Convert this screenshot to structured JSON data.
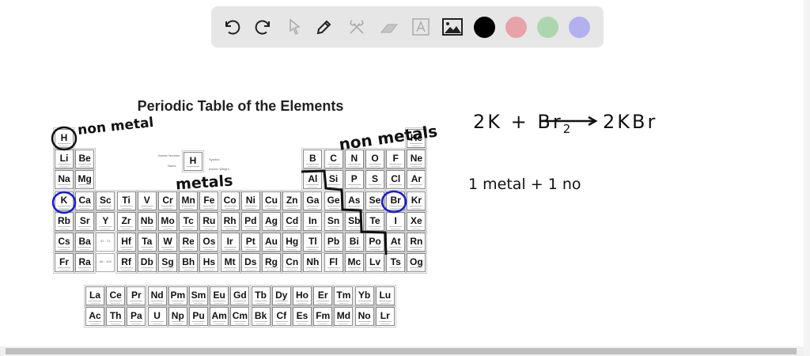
{
  "toolbar": {
    "tools": [
      "undo-icon",
      "redo-icon",
      "select-icon",
      "pen-icon",
      "tools-icon",
      "eraser-icon",
      "text-icon",
      "image-icon"
    ],
    "colors": [
      "#000000",
      "#e8a2aa",
      "#aed6ae",
      "#b2b0ee"
    ]
  },
  "periodic_table": {
    "title": "Periodic Table of the Elements",
    "rows": [
      [
        "H",
        "",
        "",
        "",
        "",
        "",
        "",
        "",
        "",
        "",
        "",
        "",
        "",
        "",
        "",
        "",
        "",
        "He"
      ],
      [
        "Li",
        "Be",
        "",
        "",
        "",
        "",
        "",
        "",
        "",
        "",
        "",
        "",
        "B",
        "C",
        "N",
        "O",
        "F",
        "Ne"
      ],
      [
        "Na",
        "Mg",
        "",
        "",
        "",
        "",
        "",
        "",
        "",
        "",
        "",
        "",
        "Al",
        "Si",
        "P",
        "S",
        "Cl",
        "Ar"
      ],
      [
        "K",
        "Ca",
        "Sc",
        "Ti",
        "V",
        "Cr",
        "Mn",
        "Fe",
        "Co",
        "Ni",
        "Cu",
        "Zn",
        "Ga",
        "Ge",
        "As",
        "Se",
        "Br",
        "Kr"
      ],
      [
        "Rb",
        "Sr",
        "Y",
        "Zr",
        "Nb",
        "Mo",
        "Tc",
        "Ru",
        "Rh",
        "Pd",
        "Ag",
        "Cd",
        "In",
        "Sn",
        "Sb",
        "Te",
        "I",
        "Xe"
      ],
      [
        "Cs",
        "Ba",
        "57 - 71",
        "Hf",
        "Ta",
        "W",
        "Re",
        "Os",
        "Ir",
        "Pt",
        "Au",
        "Hg",
        "Tl",
        "Pb",
        "Bi",
        "Po",
        "At",
        "Rn"
      ],
      [
        "Fr",
        "Ra",
        "89 - 103",
        "Rf",
        "Db",
        "Sg",
        "Bh",
        "Hs",
        "Mt",
        "Ds",
        "Rg",
        "Cn",
        "Nh",
        "Fl",
        "Mc",
        "Lv",
        "Ts",
        "Og"
      ]
    ],
    "lanthanides": [
      "La",
      "Ce",
      "Pr",
      "Nd",
      "Pm",
      "Sm",
      "Eu",
      "Gd",
      "Tb",
      "Dy",
      "Ho",
      "Er",
      "Tm",
      "Yb",
      "Lu"
    ],
    "actinides": [
      "Ac",
      "Th",
      "Pa",
      "U",
      "Np",
      "Pu",
      "Am",
      "Cm",
      "Bk",
      "Cf",
      "Es",
      "Fm",
      "Md",
      "No",
      "Lr"
    ],
    "key": {
      "symbol": "H",
      "name": "Hydrogen",
      "labels": [
        "Atomic Number",
        "Name",
        "Symbol",
        "Atomic Weight"
      ]
    }
  },
  "annotations": {
    "nonmetal_h": "non metal",
    "nonmetals": "non metals",
    "metals": "metals",
    "equation": {
      "left": "2K + Br",
      "subscript": "2",
      "right": "2KBr"
    },
    "note": "1 metal + 1 no",
    "ink_colors": {
      "black": "#111111",
      "blue": "#1a1adc"
    }
  }
}
